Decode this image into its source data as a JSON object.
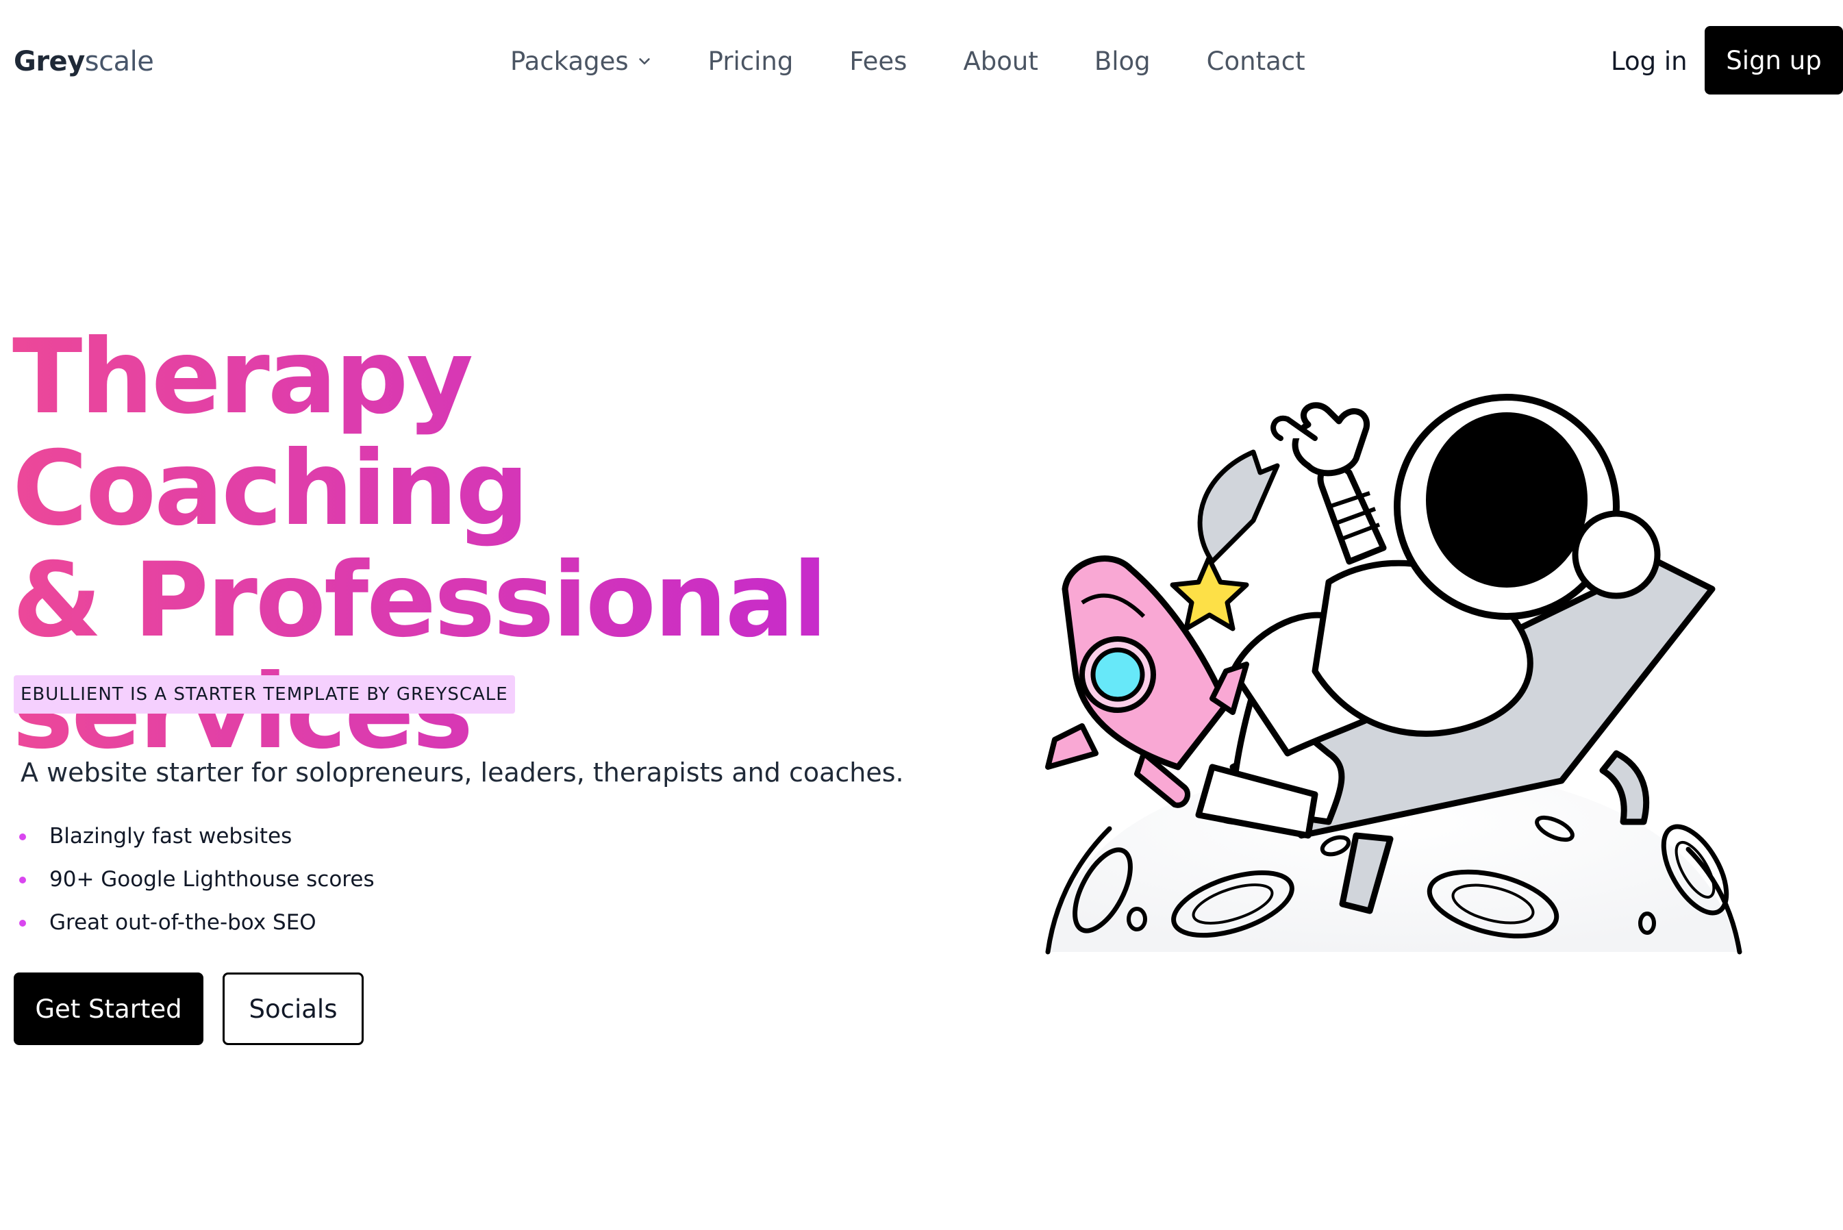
{
  "brand": {
    "bold": "Grey",
    "light": "scale"
  },
  "nav": {
    "items": [
      {
        "label": "Packages",
        "has_dropdown": true
      },
      {
        "label": "Pricing"
      },
      {
        "label": "Fees"
      },
      {
        "label": "About"
      },
      {
        "label": "Blog"
      },
      {
        "label": "Contact"
      }
    ],
    "login_label": "Log in",
    "signup_label": "Sign up"
  },
  "hero": {
    "headline_lines": [
      "Therapy Coaching",
      "& Professional",
      "services"
    ],
    "badge": "EBULLIENT IS A STARTER TEMPLATE BY GREYSCALE",
    "subtitle": "A website starter for solopreneurs, leaders, therapists and coaches.",
    "features": [
      "Blazingly fast websites",
      "90+ Google Lighthouse scores",
      "Great out-of-the-box SEO"
    ],
    "primary_button": "Get Started",
    "secondary_button": "Socials"
  },
  "colors": {
    "gradient_start": "#ec4899",
    "gradient_end": "#c026d3",
    "badge_bg": "#f5d0fe",
    "bullet": "#d946ef",
    "button_bg": "#000000"
  },
  "illustration": {
    "icons": [
      "astronaut-icon",
      "rocket-icon",
      "star-icon",
      "moon-icon",
      "lounge-chair-icon"
    ]
  }
}
